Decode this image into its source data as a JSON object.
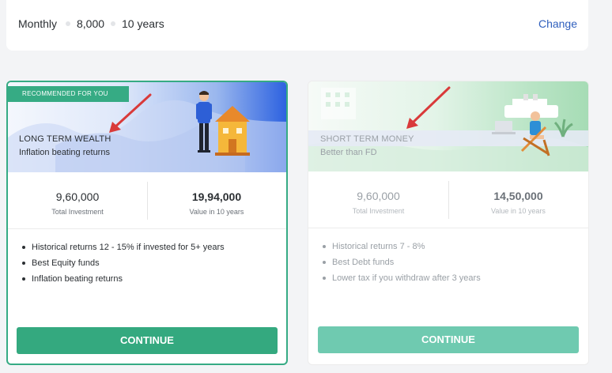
{
  "summary": {
    "frequency": "Monthly",
    "amount": "8,000",
    "duration": "10 years",
    "change_label": "Change"
  },
  "plans": {
    "long_term": {
      "badge": "RECOMMENDED FOR YOU",
      "title": "LONG TERM WEALTH",
      "subtitle": "Inflation beating returns",
      "total_investment_value": "9,60,000",
      "total_investment_label": "Total Investment",
      "future_value": "19,94,000",
      "future_value_label": "Value in 10 years",
      "features": [
        "Historical returns 12 - 15% if invested for 5+ years",
        "Best Equity funds",
        "Inflation beating returns"
      ],
      "cta": "CONTINUE",
      "selected": true
    },
    "short_term": {
      "title": "SHORT TERM MONEY",
      "subtitle": "Better than FD",
      "total_investment_value": "9,60,000",
      "total_investment_label": "Total Investment",
      "future_value": "14,50,000",
      "future_value_label": "Value in 10 years",
      "features": [
        "Historical returns 7 - 8%",
        "Best Debt funds",
        "Lower tax if you withdraw after 3 years"
      ],
      "cta": "CONTINUE",
      "selected": false
    }
  },
  "colors": {
    "accent_green": "#36ab84",
    "link_blue": "#2f5fbd",
    "arrow_red": "#d93a3a",
    "banner_blue": "#2d62e0",
    "banner_green": "#a6dcb5"
  },
  "icons": {
    "long_term_illustration": "man-with-house-illustration",
    "short_term_illustration": "person-relaxing-on-beach-chair-illustration",
    "annotation": "red-arrow-icon"
  }
}
